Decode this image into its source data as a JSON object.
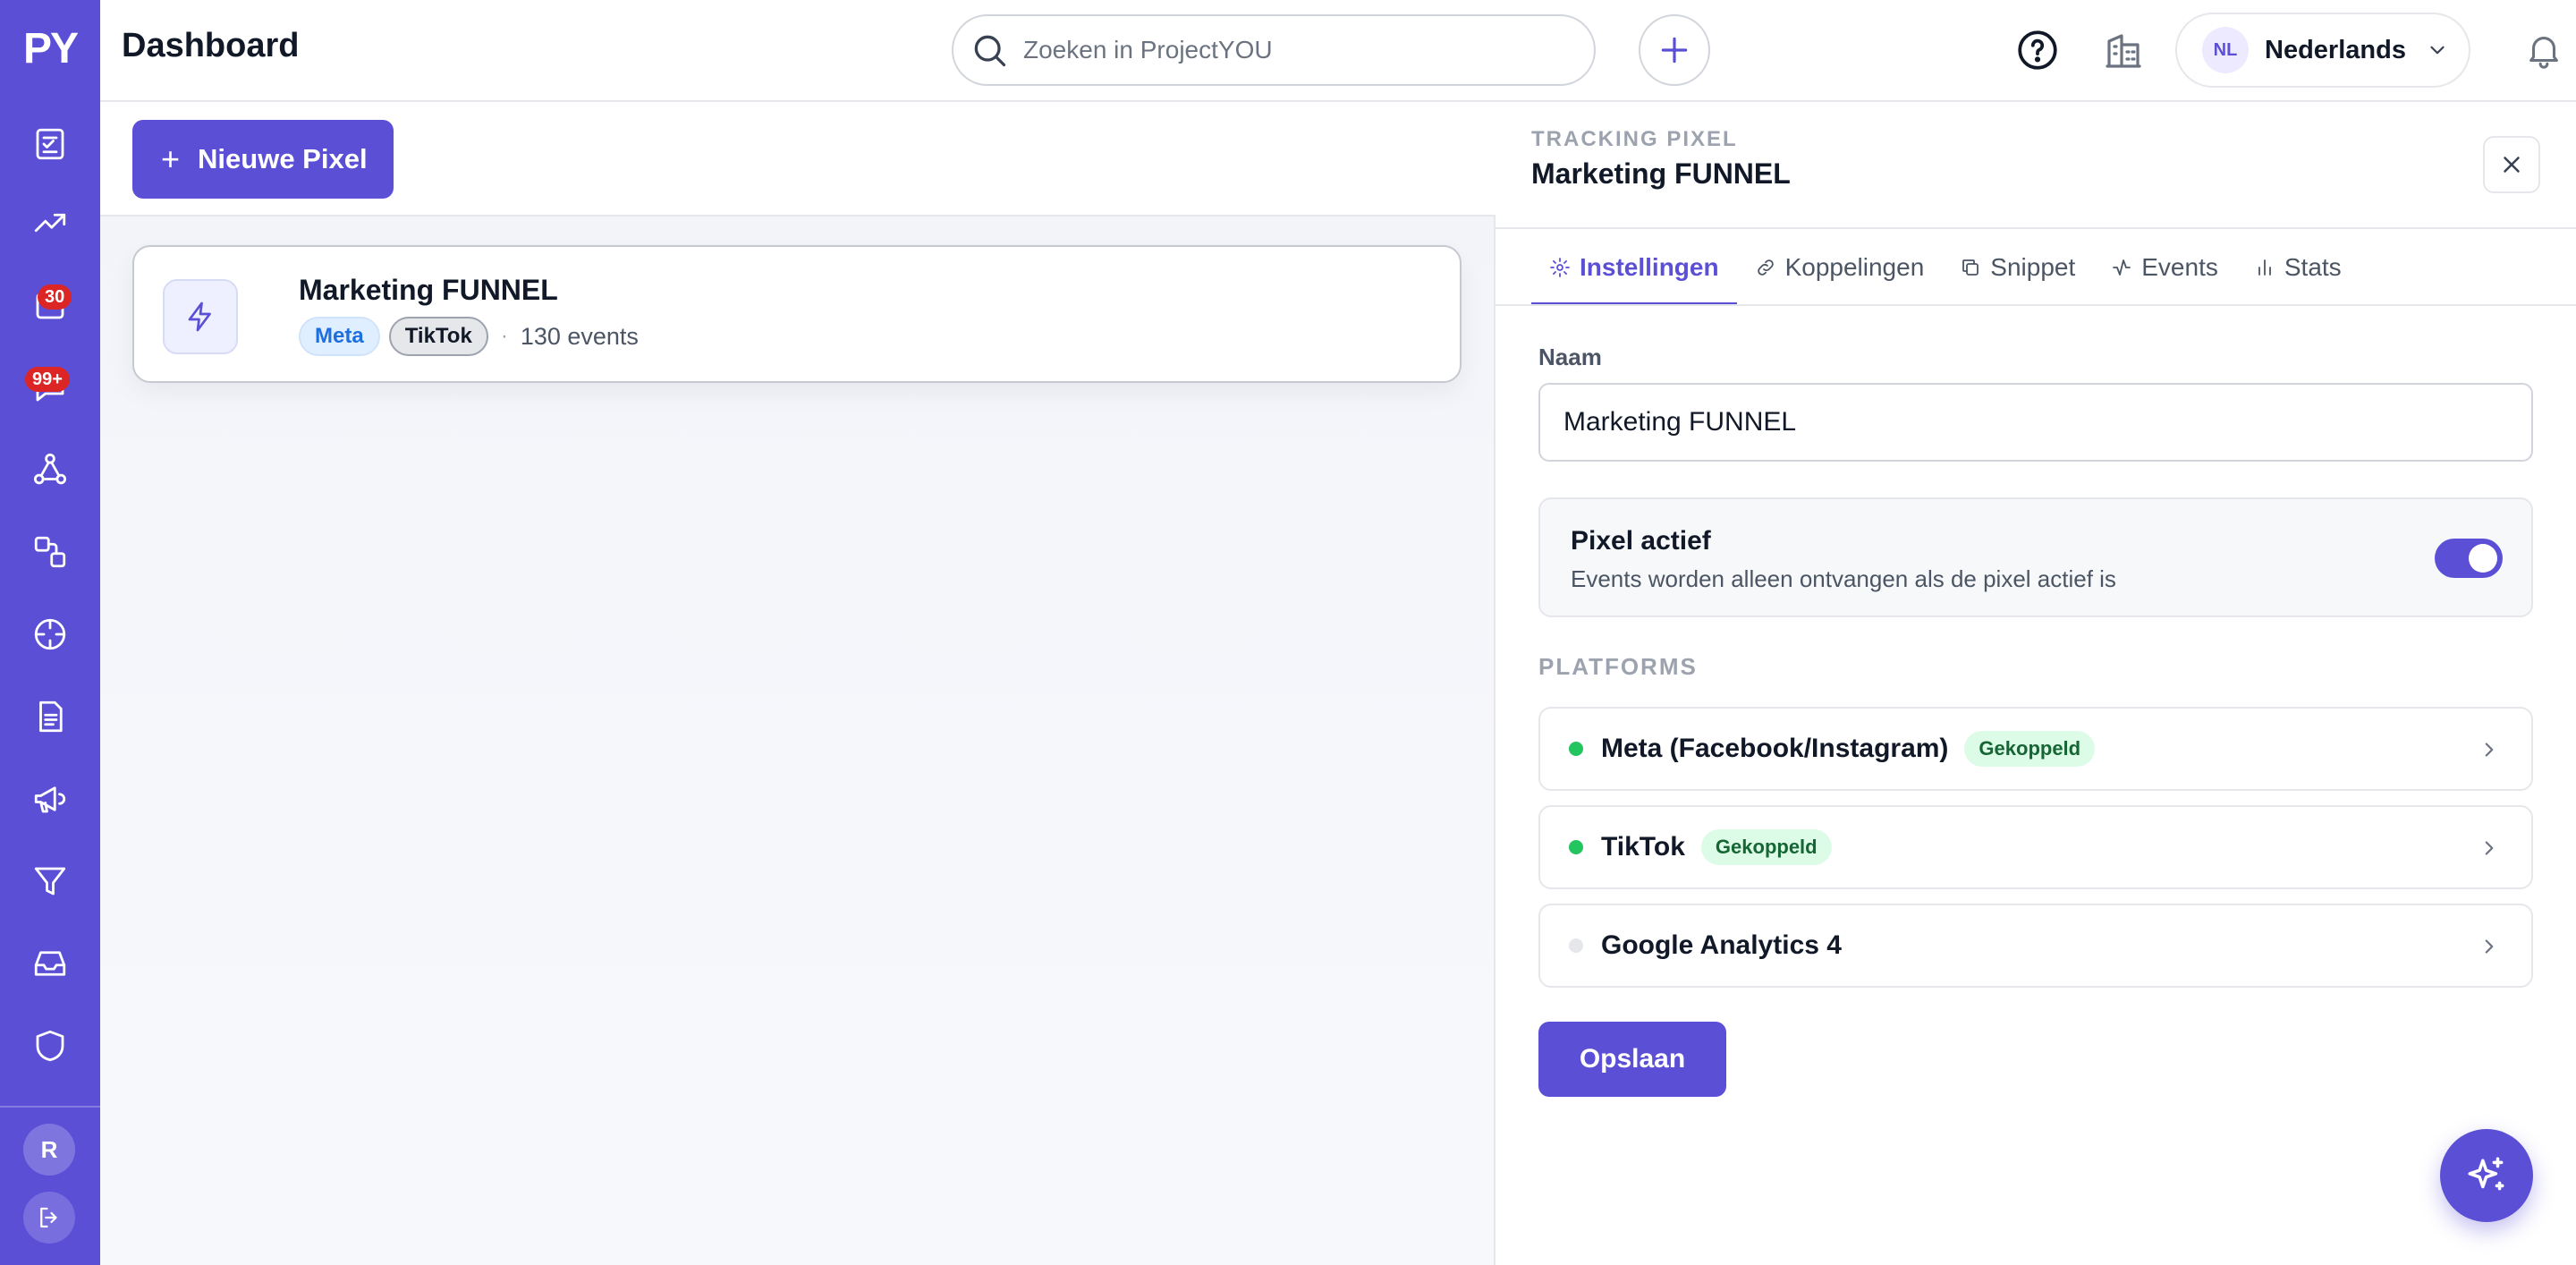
{
  "app": {
    "logo": "PY",
    "title": "Dashboard",
    "brand_color": "#5b4fd6"
  },
  "sidebar": {
    "items": [
      {
        "icon": "tasks-icon",
        "badge": null
      },
      {
        "icon": "trending-up-icon",
        "badge": null
      },
      {
        "icon": "calendar-icon",
        "badge": "30"
      },
      {
        "icon": "messages-icon",
        "badge": "99+"
      },
      {
        "icon": "network-icon",
        "badge": null
      },
      {
        "icon": "workflow-icon",
        "badge": null
      },
      {
        "icon": "crosshair-icon",
        "badge": null
      },
      {
        "icon": "document-icon",
        "badge": null
      },
      {
        "icon": "megaphone-icon",
        "badge": null
      },
      {
        "icon": "funnel-icon",
        "badge": null
      },
      {
        "icon": "inbox-icon",
        "badge": null
      },
      {
        "icon": "shield-icon",
        "badge": null
      }
    ],
    "user_initial": "R"
  },
  "header": {
    "search_placeholder": "Zoeken in ProjectYOU",
    "language_code": "NL",
    "language_label": "Nederlands"
  },
  "list": {
    "new_button_label": "Nieuwe Pixel",
    "pixels": [
      {
        "name": "Marketing FUNNEL",
        "tags": [
          "Meta",
          "TikTok"
        ],
        "events": "130 events"
      }
    ]
  },
  "detail": {
    "eyebrow": "TRACKING PIXEL",
    "title": "Marketing FUNNEL",
    "tabs": [
      {
        "label": "Instellingen",
        "active": true
      },
      {
        "label": "Koppelingen",
        "active": false
      },
      {
        "label": "Snippet",
        "active": false
      },
      {
        "label": "Events",
        "active": false
      },
      {
        "label": "Stats",
        "active": false
      }
    ],
    "name_label": "Naam",
    "name_value": "Marketing FUNNEL",
    "active_title": "Pixel actief",
    "active_desc": "Events worden alleen ontvangen als de pixel actief is",
    "active_on": true,
    "platforms_heading": "PLATFORMS",
    "platforms": [
      {
        "name": "Meta (Facebook/Instagram)",
        "status": "Gekoppeld",
        "connected": true
      },
      {
        "name": "TikTok",
        "status": "Gekoppeld",
        "connected": true
      },
      {
        "name": "Google Analytics 4",
        "status": "",
        "connected": false
      }
    ],
    "save_label": "Opslaan"
  }
}
